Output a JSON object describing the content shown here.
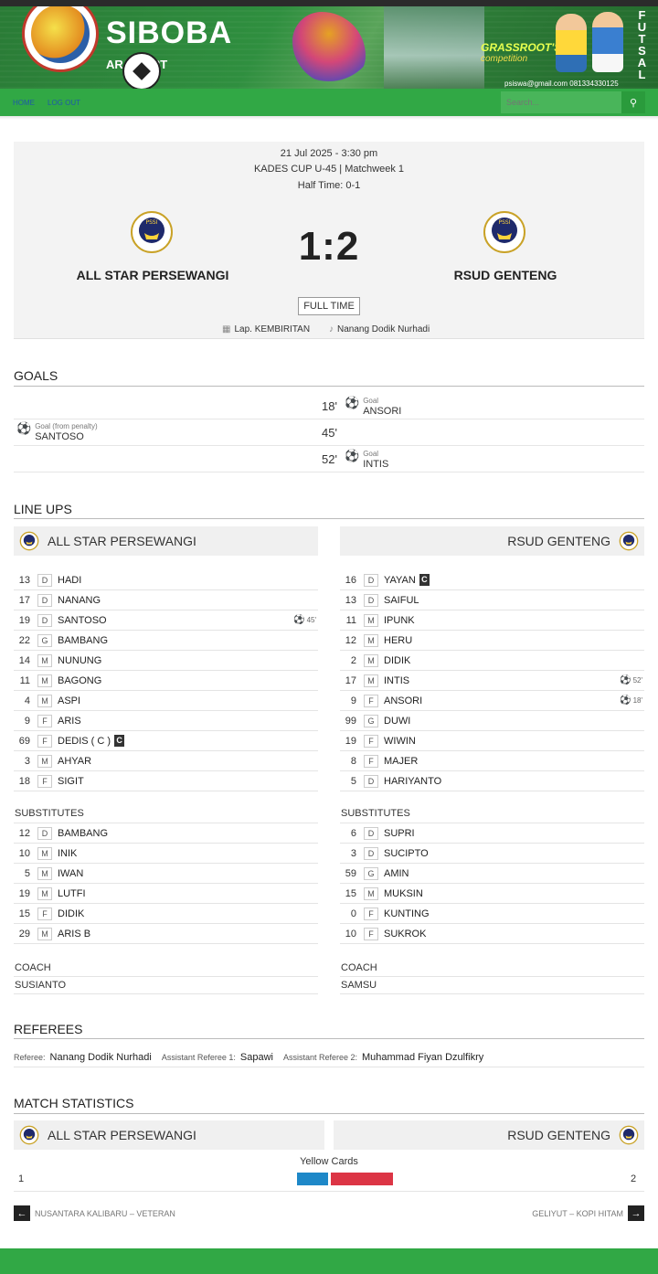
{
  "site": {
    "title": "SIBOBA",
    "subtitle": "AR SPORT",
    "tagline": "GRASSROOT'S",
    "tagline2": "competition",
    "futsal": "FUTSAL",
    "contact": "psiswa@gmail.com   081334330125"
  },
  "nav": {
    "home": "HOME",
    "logout": "LOG OUT",
    "search_placeholder": "Search..."
  },
  "match": {
    "date": "21 Jul 2025 - 3:30 pm",
    "competition": "KADES CUP U-45",
    "matchweek": "Matchweek 1",
    "separator": "|",
    "half_time": "Half Time: 0-1",
    "home_team": "ALL STAR PERSEWANGI",
    "away_team": "RSUD GENTENG",
    "score": "1:2",
    "status": "FULL TIME",
    "venue": "Lap. KEMBIRITAN",
    "referee": "Nanang Dodik Nurhadi"
  },
  "goals": {
    "heading": "GOALS",
    "items": [
      {
        "minute": "18'",
        "type": "Goal",
        "player": "ANSORI",
        "side": "away"
      },
      {
        "minute": "45'",
        "type": "Goal (from penalty)",
        "player": "SANTOSO",
        "side": "home"
      },
      {
        "minute": "52'",
        "type": "Goal",
        "player": "INTIS",
        "side": "away"
      }
    ]
  },
  "lineups": {
    "heading": "LINE UPS",
    "substitutes_label": "SUBSTITUTES",
    "coach_label": "COACH",
    "home": {
      "team": "ALL STAR PERSEWANGI",
      "starters": [
        {
          "num": "13",
          "pos": "D",
          "name": "HADI"
        },
        {
          "num": "17",
          "pos": "D",
          "name": "NANANG"
        },
        {
          "num": "19",
          "pos": "D",
          "name": "SANTOSO",
          "event": "45'"
        },
        {
          "num": "22",
          "pos": "G",
          "name": "BAMBANG"
        },
        {
          "num": "14",
          "pos": "M",
          "name": "NUNUNG"
        },
        {
          "num": "11",
          "pos": "M",
          "name": "BAGONG"
        },
        {
          "num": "4",
          "pos": "M",
          "name": "ASPI"
        },
        {
          "num": "9",
          "pos": "F",
          "name": "ARIS"
        },
        {
          "num": "69",
          "pos": "F",
          "name": "DEDIS ( C )",
          "captain": "C"
        },
        {
          "num": "3",
          "pos": "M",
          "name": "AHYAR"
        },
        {
          "num": "18",
          "pos": "F",
          "name": "SIGIT"
        }
      ],
      "subs": [
        {
          "num": "12",
          "pos": "D",
          "name": "BAMBANG"
        },
        {
          "num": "10",
          "pos": "M",
          "name": "INIK"
        },
        {
          "num": "5",
          "pos": "M",
          "name": "IWAN"
        },
        {
          "num": "19",
          "pos": "M",
          "name": "LUTFI"
        },
        {
          "num": "15",
          "pos": "F",
          "name": "DIDIK"
        },
        {
          "num": "29",
          "pos": "M",
          "name": "ARIS B"
        }
      ],
      "coach": "SUSIANTO"
    },
    "away": {
      "team": "RSUD GENTENG",
      "starters": [
        {
          "num": "16",
          "pos": "D",
          "name": "YAYAN",
          "captain": "C"
        },
        {
          "num": "13",
          "pos": "D",
          "name": "SAIFUL"
        },
        {
          "num": "11",
          "pos": "M",
          "name": "IPUNK"
        },
        {
          "num": "12",
          "pos": "M",
          "name": "HERU"
        },
        {
          "num": "2",
          "pos": "M",
          "name": "DIDIK"
        },
        {
          "num": "17",
          "pos": "M",
          "name": "INTIS",
          "event": "52'"
        },
        {
          "num": "9",
          "pos": "F",
          "name": "ANSORI",
          "event": "18'"
        },
        {
          "num": "99",
          "pos": "G",
          "name": "DUWI"
        },
        {
          "num": "19",
          "pos": "F",
          "name": "WIWIN"
        },
        {
          "num": "8",
          "pos": "F",
          "name": "MAJER"
        },
        {
          "num": "5",
          "pos": "D",
          "name": "HARIYANTO"
        }
      ],
      "subs": [
        {
          "num": "6",
          "pos": "D",
          "name": "SUPRI"
        },
        {
          "num": "3",
          "pos": "D",
          "name": "SUCIPTO"
        },
        {
          "num": "59",
          "pos": "G",
          "name": "AMIN"
        },
        {
          "num": "15",
          "pos": "M",
          "name": "MUKSIN"
        },
        {
          "num": "0",
          "pos": "F",
          "name": "KUNTING"
        },
        {
          "num": "10",
          "pos": "F",
          "name": "SUKROK"
        }
      ],
      "coach": "SAMSU"
    }
  },
  "referees": {
    "heading": "REFEREES",
    "referee_label": "Referee:",
    "referee": "Nanang Dodik Nurhadi",
    "assistant1_label": "Assistant Referee 1:",
    "assistant1": "Sapawi",
    "assistant2_label": "Assistant Referee 2:",
    "assistant2": "Muhammad Fiyan Dzulfikry"
  },
  "stats": {
    "heading": "MATCH STATISTICS",
    "home_team": "ALL STAR PERSEWANGI",
    "away_team": "RSUD GENTENG",
    "label": "Yellow Cards",
    "home_value": 1,
    "away_value": 2,
    "home_color": "#1e88c8",
    "away_color": "#dc3545"
  },
  "pager": {
    "prev": "NUSANTARA KALIBARU – VETERAN",
    "next": "GELIYUT – KOPI HITAM",
    "prev_icon": "arrow-left-icon",
    "next_icon": "arrow-right-icon"
  },
  "colors": {
    "nav_green": "#31a845",
    "card_bg": "#f3f3f3"
  }
}
